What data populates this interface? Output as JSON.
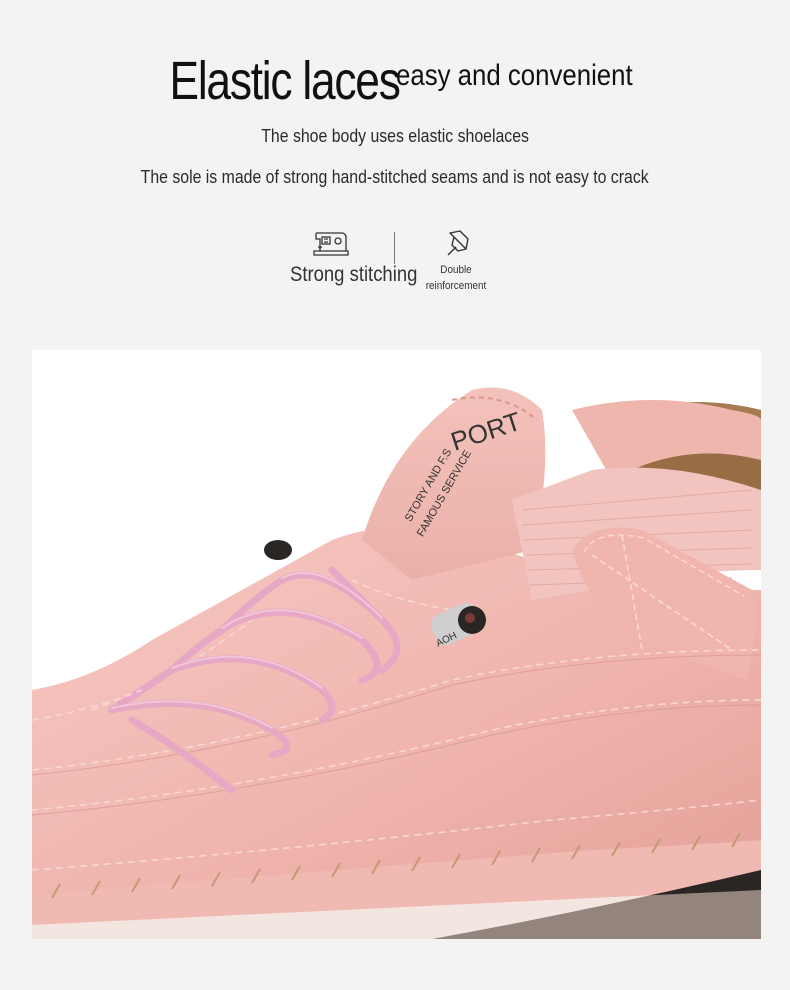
{
  "headline": {
    "main": "Elastic laces",
    "secondary": "easy and convenient"
  },
  "subtitles": [
    "The shoe body uses elastic shoelaces",
    "The sole is made of strong hand-stitched seams and is not easy to crack"
  ],
  "features": [
    {
      "label": "Strong stitching",
      "icon": "sewing-machine-icon"
    },
    {
      "label_line1": "Double",
      "label_line2": "reinforcement",
      "icon": "pushpin-icon"
    }
  ],
  "photo": {
    "tongue_text": "PORT",
    "tongue_slogan": "STORY AND F.S\nFAMOUS SERVICE",
    "aglet_text": "AOH",
    "colors": {
      "leather": "#f1b9b3",
      "lace": "#e7a8c6",
      "sole": "#2a2624",
      "lining": "#a77a52"
    }
  }
}
